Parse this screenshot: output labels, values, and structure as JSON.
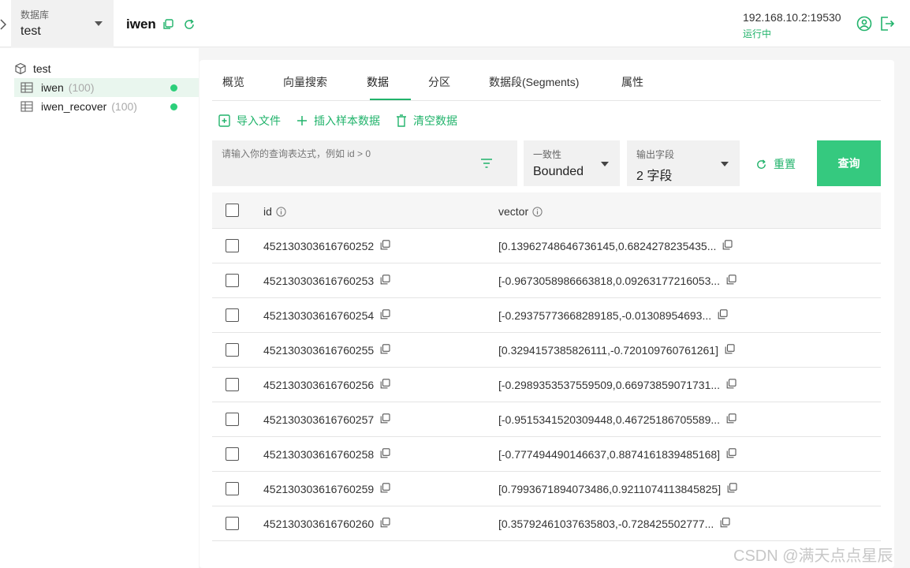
{
  "topbar": {
    "db_label": "数据库",
    "db_value": "test",
    "collection_title": "iwen",
    "server_address": "192.168.10.2:19530",
    "server_status": "运行中"
  },
  "sidebar": {
    "database": "test",
    "items": [
      {
        "name": "iwen",
        "count": "(100)",
        "active": true
      },
      {
        "name": "iwen_recover",
        "count": "(100)",
        "active": false
      }
    ]
  },
  "tabs": [
    "概览",
    "向量搜索",
    "数据",
    "分区",
    "数据段(Segments)",
    "属性"
  ],
  "active_tab": "数据",
  "actions": {
    "import": "导入文件",
    "insert_sample": "插入样本数据",
    "clear": "清空数据"
  },
  "query": {
    "placeholder": "请输入你的查询表达式，例如 id > 0",
    "consistency_label": "一致性",
    "consistency_value": "Bounded",
    "output_label": "输出字段",
    "output_value": "2 字段",
    "reset_label": "重置",
    "query_label": "查询"
  },
  "table": {
    "columns": [
      "id",
      "vector"
    ],
    "rows": [
      {
        "id": "452130303616760252",
        "vector": "[0.13962748646736145,0.6824278235435..."
      },
      {
        "id": "452130303616760253",
        "vector": "[-0.9673058986663818,0.09263177216053..."
      },
      {
        "id": "452130303616760254",
        "vector": "[-0.29375773668289185,-0.01308954693..."
      },
      {
        "id": "452130303616760255",
        "vector": "[0.3294157385826111,-0.720109760761261]"
      },
      {
        "id": "452130303616760256",
        "vector": "[-0.2989353537559509,0.66973859071731..."
      },
      {
        "id": "452130303616760257",
        "vector": "[-0.9515341520309448,0.46725186705589..."
      },
      {
        "id": "452130303616760258",
        "vector": "[-0.777494490146637,0.8874161839485168]"
      },
      {
        "id": "452130303616760259",
        "vector": "[0.7993671894073486,0.9211074113845825]"
      },
      {
        "id": "452130303616760260",
        "vector": "[0.35792461037635803,-0.728425502777..."
      }
    ]
  },
  "watermark": "CSDN @满天点点星辰",
  "colors": {
    "accent": "#21b36b",
    "query_button": "#35c97f",
    "status_dot": "#2ccf7a"
  }
}
